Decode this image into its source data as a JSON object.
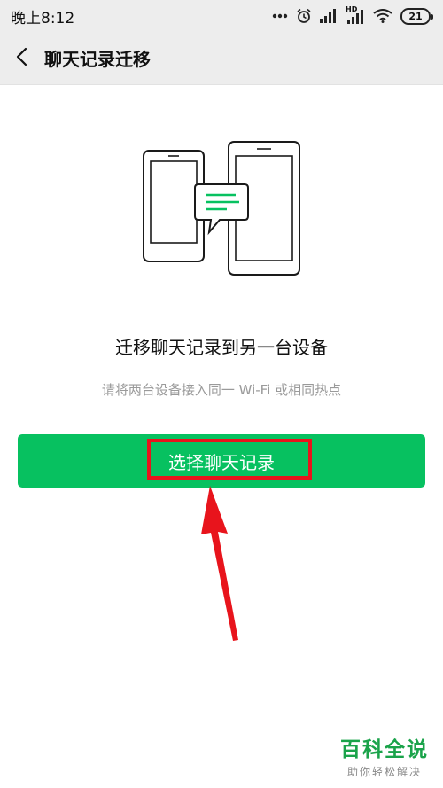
{
  "status_bar": {
    "time": "晚上8:12",
    "network_label": "HD",
    "battery_level": "21"
  },
  "header": {
    "title": "聊天记录迁移",
    "back_icon": "chevron-left-icon"
  },
  "main": {
    "illustration_icon": "phone-transfer-illustration",
    "headline": "迁移聊天记录到另一台设备",
    "subtitle": "请将两台设备接入同一 Wi-Fi 或相同热点",
    "primary_button_label": "选择聊天记录"
  },
  "overlay": {
    "highlight_color": "#e8141c",
    "arrow_icon": "red-arrow-icon"
  },
  "watermark": {
    "title": "百科全说",
    "subtitle": "助你轻松解决"
  },
  "colors": {
    "accent": "#07c160",
    "header_bg": "#ededed",
    "annotation": "#e8141c"
  }
}
